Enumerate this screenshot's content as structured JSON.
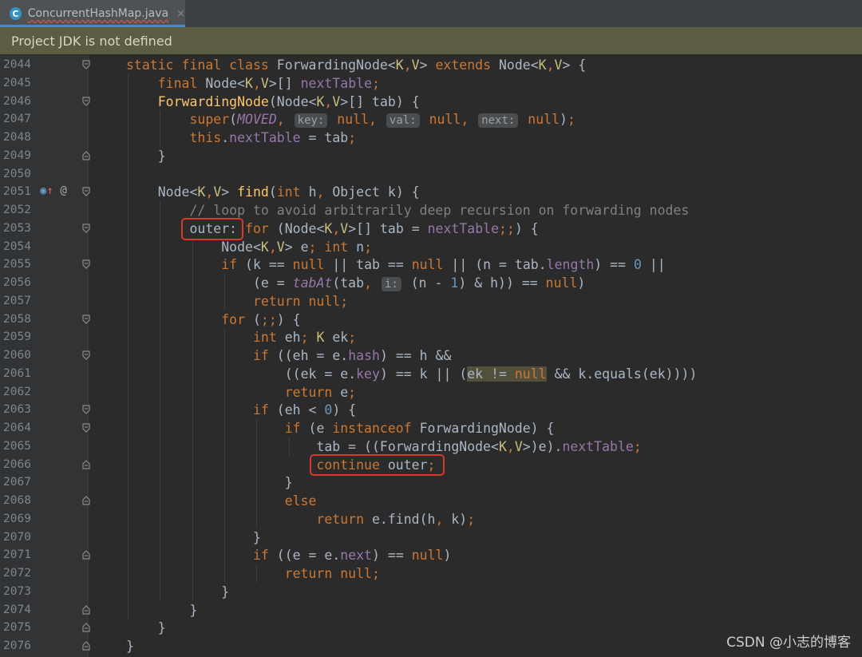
{
  "tab": {
    "label": "ConcurrentHashMap.java",
    "icon": "c-class-icon",
    "close": "×"
  },
  "notice": {
    "text": "Project JDK is not defined"
  },
  "watermark": "CSDN @小志的博客",
  "line_numbers": [
    "2044",
    "2045",
    "2046",
    "2047",
    "2048",
    "2049",
    "2050",
    "2051",
    "2052",
    "2053",
    "2054",
    "2055",
    "2056",
    "2057",
    "2058",
    "2059",
    "2060",
    "2061",
    "2062",
    "2063",
    "2064",
    "2065",
    "2066",
    "2067",
    "2068",
    "2069",
    "2070",
    "2071",
    "2072",
    "2073",
    "2074",
    "2075",
    "2076"
  ],
  "gutter_marks": {
    "2051": "override-and-annotation-icons"
  },
  "code": [
    "static final class ForwardingNode<K,V> extends Node<K,V> {",
    "    final Node<K,V>[] nextTable;",
    "    ForwardingNode(Node<K,V>[] tab) {",
    "        super(MOVED, key: null, val: null, next: null);",
    "        this.nextTable = tab;",
    "    }",
    "",
    "    Node<K,V> find(int h, Object k) {",
    "        // loop to avoid arbitrarily deep recursion on forwarding nodes",
    "        outer: for (Node<K,V>[] tab = nextTable;;) {",
    "            Node<K,V> e; int n;",
    "            if (k == null || tab == null || (n = tab.length) == 0 ||",
    "                (e = tabAt(tab, i: (n - 1) & h)) == null)",
    "                return null;",
    "            for (;;) {",
    "                int eh; K ek;",
    "                if ((eh = e.hash) == h &&",
    "                    ((ek = e.key) == k || (ek != null && k.equals(ek))))",
    "                    return e;",
    "                if (eh < 0) {",
    "                    if (e instanceof ForwardingNode) {",
    "                        tab = ((ForwardingNode<K,V>)e).nextTable;",
    "                        continue outer;",
    "                    }",
    "                    else",
    "                        return e.find(h, k);",
    "                }",
    "                if ((e = e.next) == null)",
    "                    return null;",
    "            }",
    "        }",
    "    }",
    "}"
  ],
  "highlights": {
    "red_boxes": [
      "outer:",
      "continue outer;"
    ]
  }
}
